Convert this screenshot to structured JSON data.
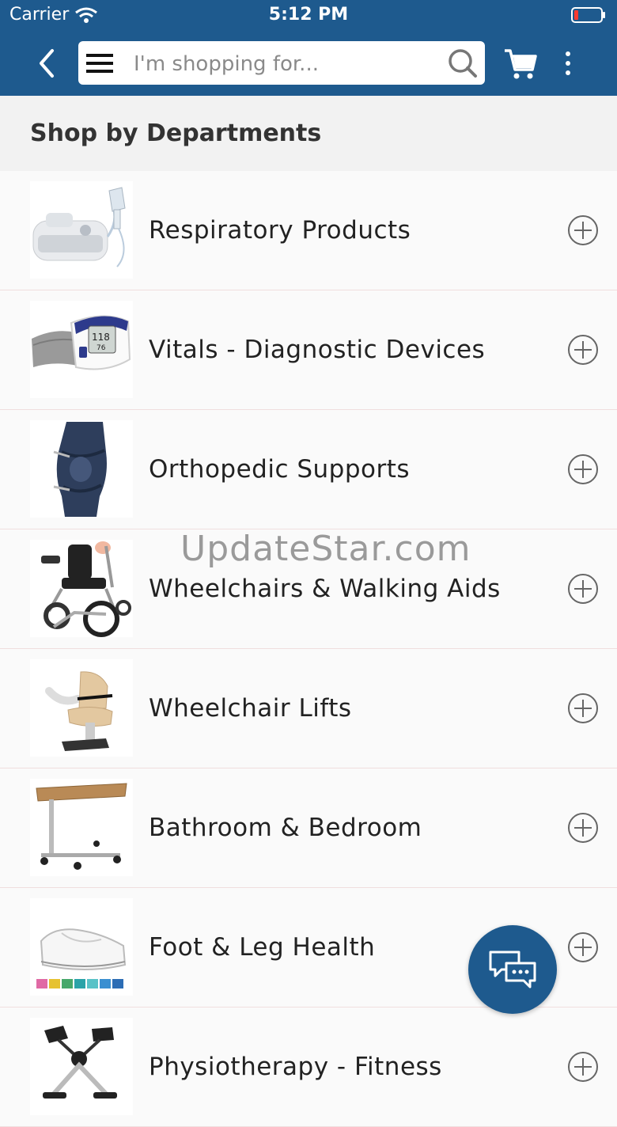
{
  "status_bar": {
    "carrier": "Carrier",
    "time": "5:12 PM"
  },
  "header": {
    "search_placeholder": "I'm shopping for...",
    "bar_color": "#1e5a8e"
  },
  "section": {
    "title": "Shop by Departments"
  },
  "departments": [
    {
      "label": "Respiratory Products",
      "icon": "nebulizer-image"
    },
    {
      "label": "Vitals - Diagnostic Devices",
      "icon": "blood-pressure-monitor-image"
    },
    {
      "label": "Orthopedic Supports",
      "icon": "knee-brace-image"
    },
    {
      "label": "Wheelchairs & Walking Aids",
      "icon": "wheelchair-image"
    },
    {
      "label": "Wheelchair Lifts",
      "icon": "stairlift-image"
    },
    {
      "label": "Bathroom & Bedroom",
      "icon": "overbed-table-image"
    },
    {
      "label": "Foot & Leg Health",
      "icon": "shoe-image"
    },
    {
      "label": "Physiotherapy - Fitness",
      "icon": "pedal-exerciser-image"
    }
  ],
  "watermark": "UpdateStar.com"
}
